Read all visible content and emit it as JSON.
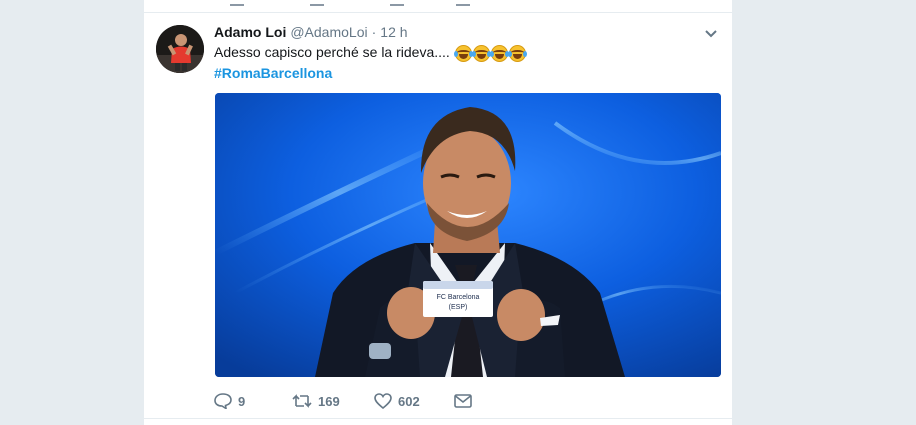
{
  "tweet": {
    "author_name": "Adamo Loi",
    "author_handle": "@AdamoLoi",
    "separator": "·",
    "time": "12 h",
    "text": "Adesso capisco perché se la rideva....",
    "emojis": [
      "face-with-tears-of-joy",
      "face-with-tears-of-joy",
      "face-with-tears-of-joy",
      "face-with-tears-of-joy"
    ],
    "hashtag": "#RomaBarcellona",
    "media": {
      "card_line1": "FC Barcelona",
      "card_line2": "(ESP)"
    },
    "actions": {
      "reply_count": "9",
      "retweet_count": "169",
      "like_count": "602"
    }
  },
  "icons": {
    "reply": "speech-bubble-icon",
    "retweet": "retweet-arrows-icon",
    "like": "heart-icon",
    "dm": "envelope-icon",
    "caret": "chevron-down-icon"
  },
  "colors": {
    "link": "#1b95e0",
    "muted": "#657786",
    "text": "#14171a",
    "page_bg": "#e6ecf0"
  }
}
